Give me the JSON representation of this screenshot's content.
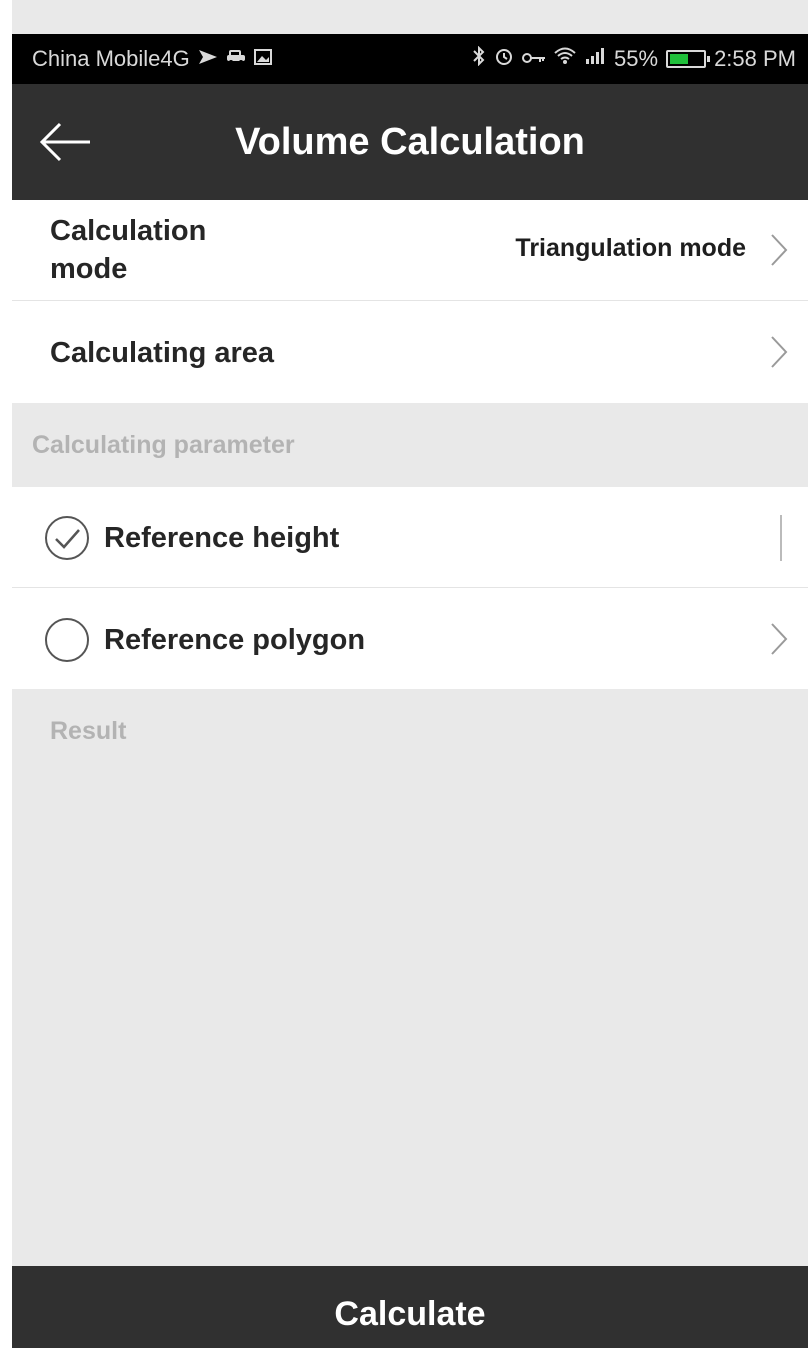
{
  "status_bar": {
    "carrier": "China Mobile4G",
    "battery_percent": "55%",
    "battery_level": 0.55,
    "time": "2:58 PM",
    "icons": [
      "send-icon",
      "car-icon",
      "image-icon",
      "bluetooth-icon",
      "alarm-icon",
      "key-icon",
      "wifi-icon",
      "signal-icon",
      "battery-icon"
    ]
  },
  "app_bar": {
    "title": "Volume Calculation",
    "back_icon": "arrow-left-icon"
  },
  "settings": {
    "calculation_mode": {
      "label": "Calculation\nmode",
      "value": "Triangulation mode"
    },
    "calculating_area": {
      "label": "Calculating area"
    }
  },
  "parameters": {
    "header": "Calculating parameter",
    "options": [
      {
        "label": "Reference height",
        "selected": true
      },
      {
        "label": "Reference polygon",
        "selected": false
      }
    ]
  },
  "result": {
    "header": "Result"
  },
  "actions": {
    "calculate_label": "Calculate"
  },
  "colors": {
    "appbar_bg": "#303030",
    "status_bg": "#000000",
    "page_bg": "#e9e9e9",
    "row_bg": "#ffffff",
    "section_text": "#b3b3b3",
    "battery_fill": "#1fbf3a"
  }
}
